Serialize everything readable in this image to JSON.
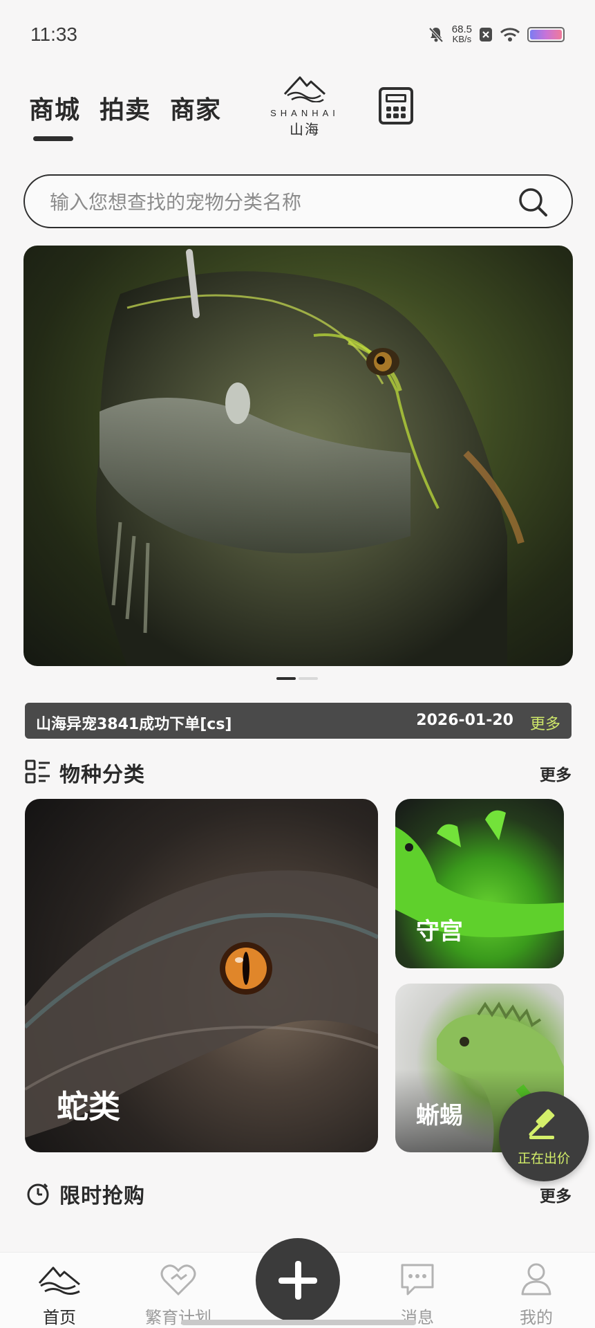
{
  "status_bar": {
    "time": "11:33",
    "net_speed_value": "68.5",
    "net_speed_unit": "KB/s",
    "icons": [
      "mute-icon",
      "sim-off-icon",
      "wifi-icon",
      "battery-icon"
    ]
  },
  "header": {
    "tabs": [
      {
        "label": "商城",
        "active": true
      },
      {
        "label": "拍卖",
        "active": false
      },
      {
        "label": "商家",
        "active": false
      }
    ],
    "logo_en": "SHANHAI",
    "logo_zh": "山海",
    "calculator_icon": "calculator-icon"
  },
  "search": {
    "placeholder": "输入您想查找的宠物分类名称",
    "value": ""
  },
  "banner": {
    "image": "iguana-closeup",
    "pager_total": 2,
    "pager_active": 1
  },
  "notice": {
    "message": "山海异宠3841成功下单[cs]",
    "date": "2026-01-20",
    "more": "更多"
  },
  "categories_section": {
    "title": "物种分类",
    "more": "更多",
    "items": [
      {
        "label": "蛇类",
        "image": "snake-eye"
      },
      {
        "label": "守宫",
        "image": "green-gecko"
      },
      {
        "label": "蜥蜴",
        "image": "green-iguana"
      }
    ]
  },
  "flash_sale_section": {
    "title": "限时抢购",
    "more": "更多"
  },
  "fab": {
    "label": "正在出价"
  },
  "bottom_nav": {
    "items": [
      {
        "label": "首页",
        "icon": "mountain-home-icon",
        "active": true
      },
      {
        "label": "繁育计划",
        "icon": "heart-plan-icon",
        "active": false
      },
      {
        "label": "消息",
        "icon": "message-icon",
        "active": false
      },
      {
        "label": "我的",
        "icon": "profile-icon",
        "active": false
      }
    ],
    "center_icon": "plus-icon"
  },
  "colors": {
    "background": "#f7f6f6",
    "dark": "#3b3b3b",
    "accent_lime": "#cfe86a",
    "inactive": "#9a9a9a"
  }
}
